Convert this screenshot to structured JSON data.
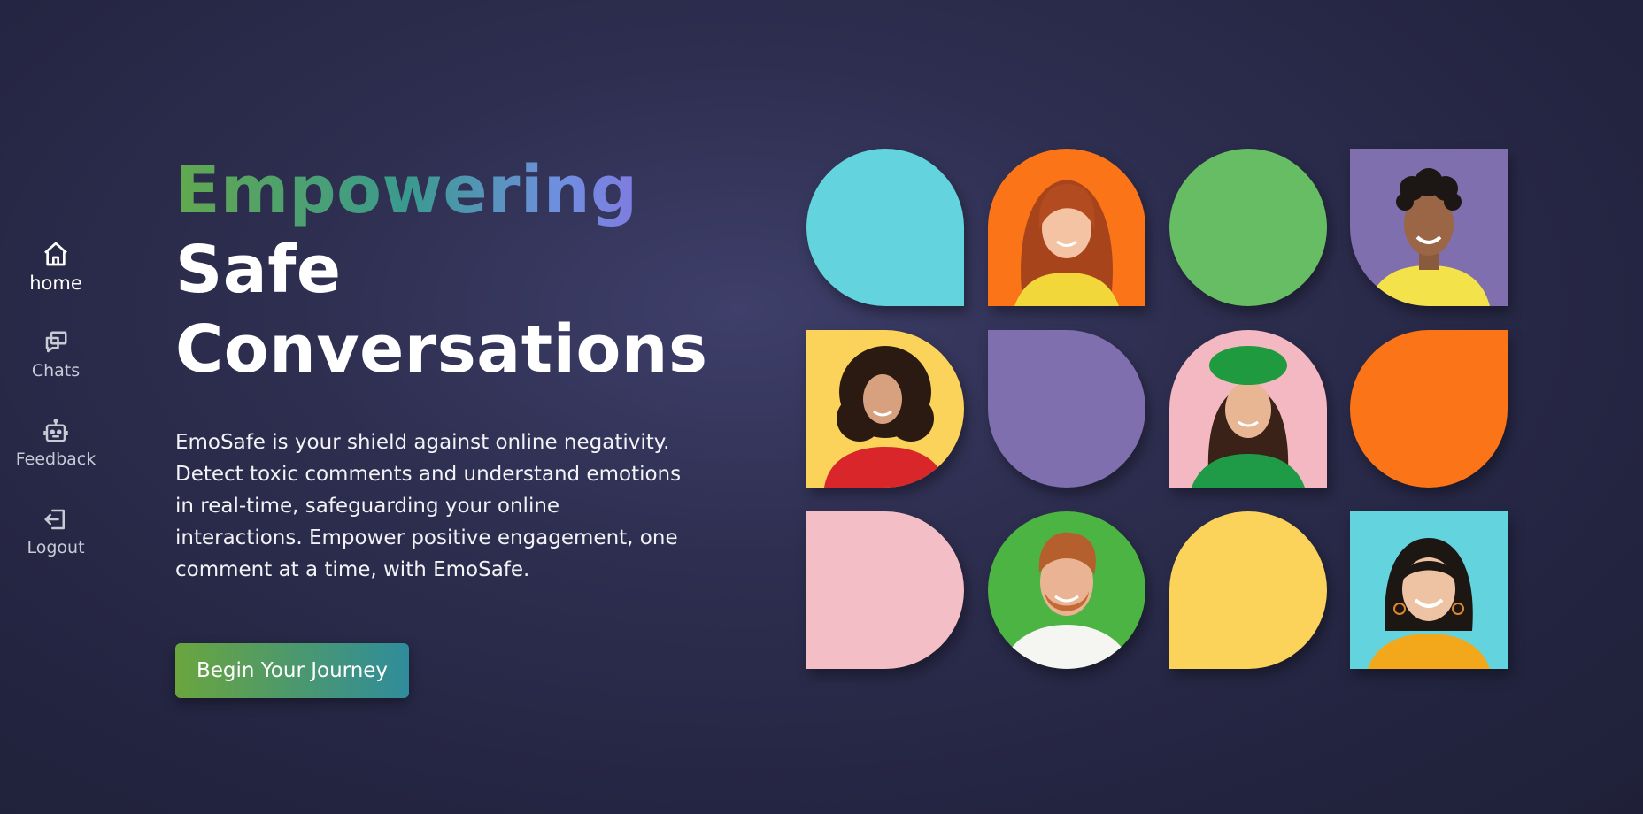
{
  "sidebar": {
    "items": [
      {
        "label": "home",
        "icon": "home-icon",
        "active": true
      },
      {
        "label": "Chats",
        "icon": "chat-icon",
        "active": false
      },
      {
        "label": "Feedback",
        "icon": "robot-icon",
        "active": false
      },
      {
        "label": "Logout",
        "icon": "logout-icon",
        "active": false
      }
    ]
  },
  "hero": {
    "title_highlight": "Empowering",
    "title_line2": "Safe",
    "title_line3": "Conversations",
    "description": "EmoSafe is your shield against online negativity. Detect toxic comments and understand emotions in real-time, safeguarding your online interactions. Empower positive engagement, one comment at a time, with EmoSafe.",
    "cta_label": "Begin Your Journey"
  },
  "colors": {
    "background": "#2a2b48",
    "cyan": "#63d4de",
    "orange": "#fb7418",
    "green": "#66bd63",
    "purple": "#7f6fae",
    "yellow": "#fbd35a",
    "pink": "#f3bec6",
    "gradient_start": "#62a84f",
    "gradient_end": "#8a6fe0"
  },
  "grid_tiles": [
    {
      "kind": "shape",
      "color": "cyan"
    },
    {
      "kind": "photo",
      "color": "orange",
      "subject": "woman with long red hair"
    },
    {
      "kind": "shape",
      "color": "green"
    },
    {
      "kind": "photo",
      "color": "purple",
      "subject": "young man with curly hair"
    },
    {
      "kind": "photo",
      "color": "yellow",
      "subject": "woman with curly hair in red top"
    },
    {
      "kind": "shape",
      "color": "purple"
    },
    {
      "kind": "photo",
      "color": "pink",
      "subject": "woman with green beret"
    },
    {
      "kind": "shape",
      "color": "orange"
    },
    {
      "kind": "shape",
      "color": "pink"
    },
    {
      "kind": "photo",
      "color": "green",
      "subject": "man with red hair and beard"
    },
    {
      "kind": "shape",
      "color": "yellow"
    },
    {
      "kind": "photo",
      "color": "cyan",
      "subject": "woman with short dark hair"
    }
  ]
}
